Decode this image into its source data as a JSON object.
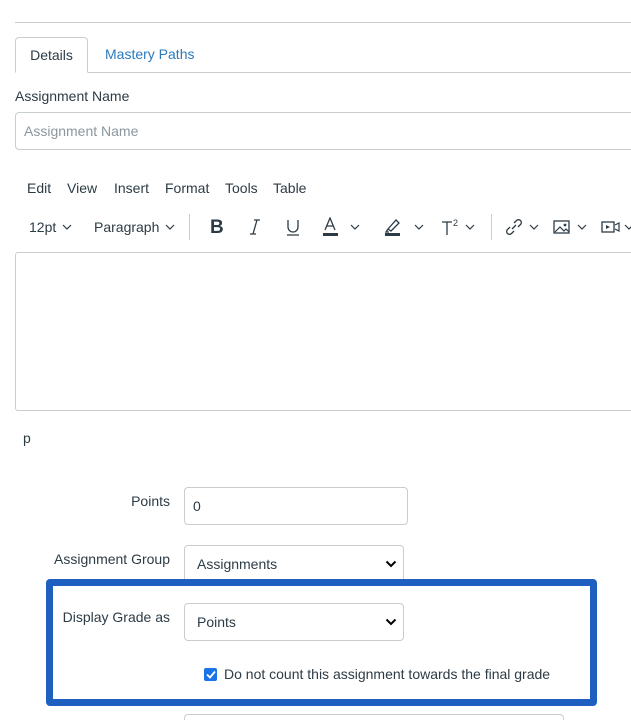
{
  "tabs": [
    {
      "label": "Details",
      "active": true
    },
    {
      "label": "Mastery Paths",
      "active": false
    }
  ],
  "assignment_name": {
    "label": "Assignment Name",
    "placeholder": "Assignment Name",
    "value": ""
  },
  "editor": {
    "menu": [
      "Edit",
      "View",
      "Insert",
      "Format",
      "Tools",
      "Table"
    ],
    "font_size": "12pt",
    "block_format": "Paragraph",
    "content": "",
    "path": "p",
    "icons": [
      "bold-icon",
      "italic-icon",
      "underline-icon",
      "text-color-icon",
      "highlight-icon",
      "superscript-icon",
      "link-icon",
      "image-icon",
      "media-icon"
    ]
  },
  "form": {
    "points": {
      "label": "Points",
      "value": "0"
    },
    "assignment_group": {
      "label": "Assignment Group",
      "value": "Assignments"
    },
    "display_grade": {
      "label": "Display Grade as",
      "value": "Points"
    },
    "omit_from_final": {
      "label": "Do not count this assignment towards the final grade",
      "checked": true
    }
  },
  "colors": {
    "accent_link": "#2b7abc",
    "highlight_border": "#1f5fbf",
    "checkbox": "#1a73e8",
    "text": "#2d3b45",
    "border": "#c7cdd1"
  }
}
